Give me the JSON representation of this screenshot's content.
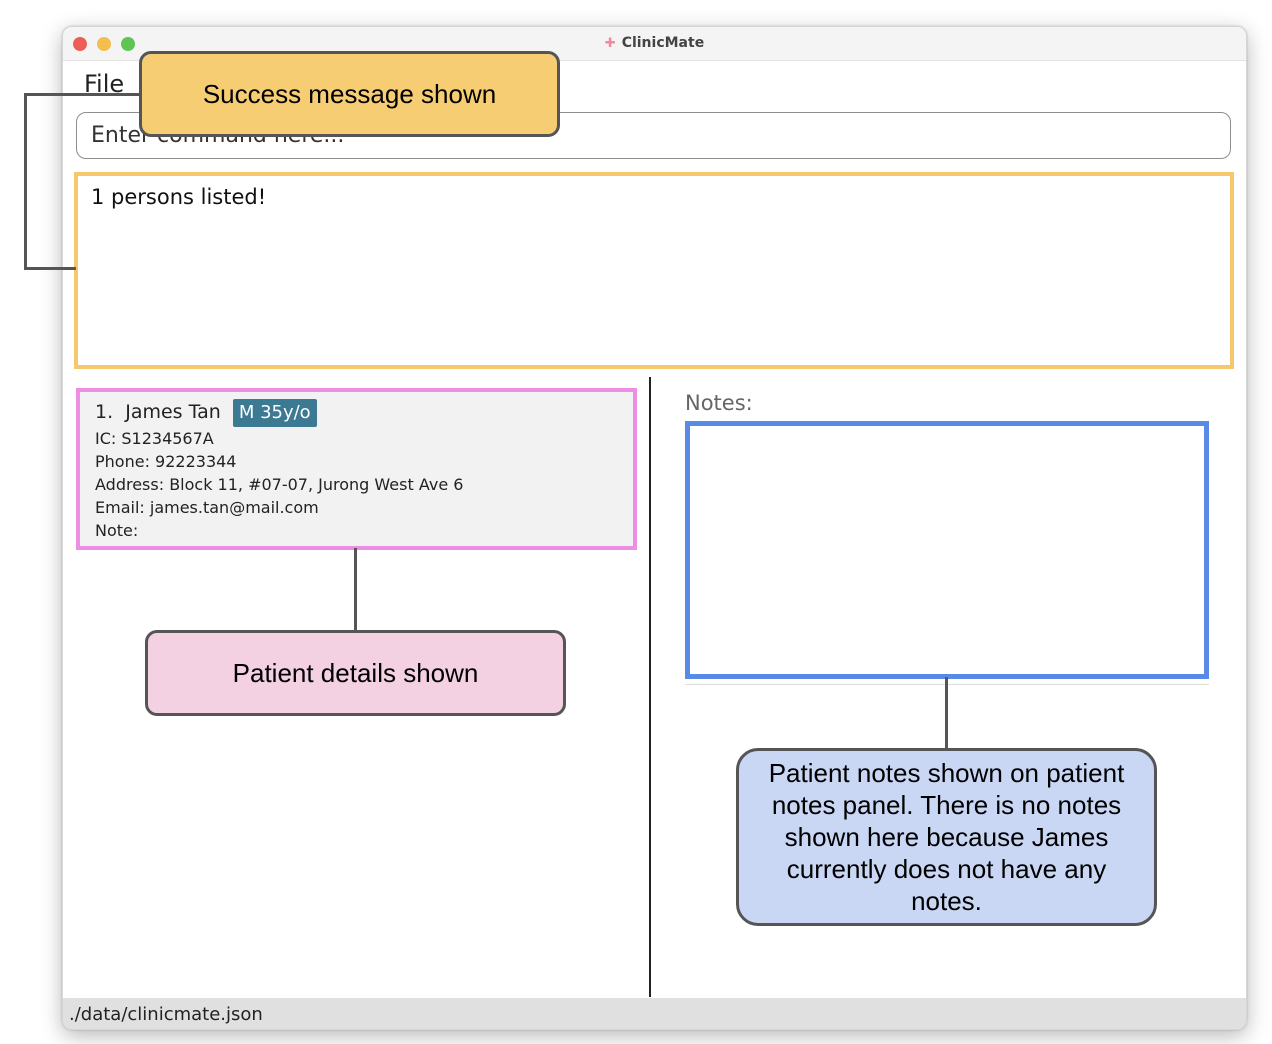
{
  "window": {
    "title": "ClinicMate",
    "app_icon": "✚"
  },
  "menu": {
    "file_label": "File"
  },
  "command_box": {
    "placeholder": "Enter command here..."
  },
  "result_display": {
    "text": "1 persons listed!"
  },
  "person_list": [
    {
      "index": "1.",
      "name": "James Tan",
      "tag": "M 35y/o",
      "ic": "IC: S1234567A",
      "phone": "Phone: 92223344",
      "address": "Address: Block 11, #07-07, Jurong West Ave 6",
      "email": "Email: james.tan@mail.com",
      "note": "Note:"
    }
  ],
  "notes_panel": {
    "label": "Notes:"
  },
  "status_bar": {
    "path": "./data/clinicmate.json"
  },
  "annotations": {
    "success": "Success message shown",
    "patient": "Patient details shown",
    "notes": "Patient notes shown on patient notes panel. There is no notes shown here because James currently does not have any notes."
  },
  "colors": {
    "success_border": "#f5c96b",
    "patient_border": "#ee8ee3",
    "notes_border": "#5a8ae8",
    "tag_bg": "#3b7a92"
  }
}
